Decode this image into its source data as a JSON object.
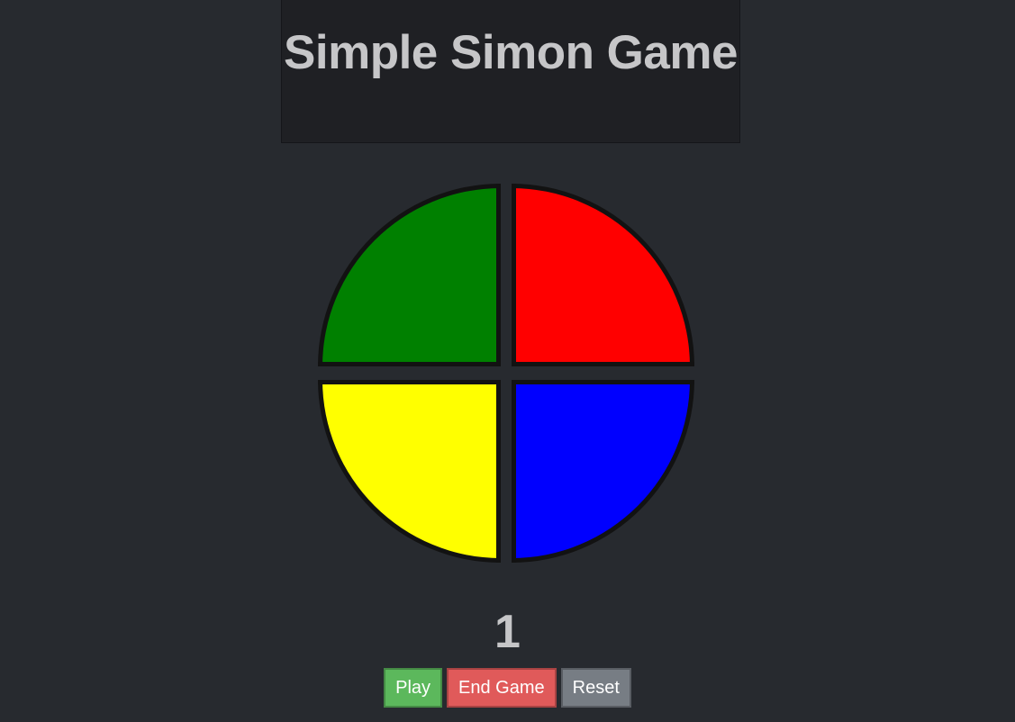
{
  "header": {
    "title": "Simple Simon Game"
  },
  "board": {
    "pads": [
      {
        "name": "green",
        "color": "#008000"
      },
      {
        "name": "red",
        "color": "#ff0000"
      },
      {
        "name": "yellow",
        "color": "#ffff00"
      },
      {
        "name": "blue",
        "color": "#0000ff"
      }
    ]
  },
  "status": {
    "score": "1"
  },
  "controls": {
    "play_label": "Play",
    "end_label": "End Game",
    "reset_label": "Reset"
  },
  "colors": {
    "background": "#272a2f",
    "header_background": "#1f2024",
    "text": "#c6c6c8",
    "play_button": "#5cb85c",
    "end_button": "#e05a5a",
    "reset_button": "#777d84"
  }
}
